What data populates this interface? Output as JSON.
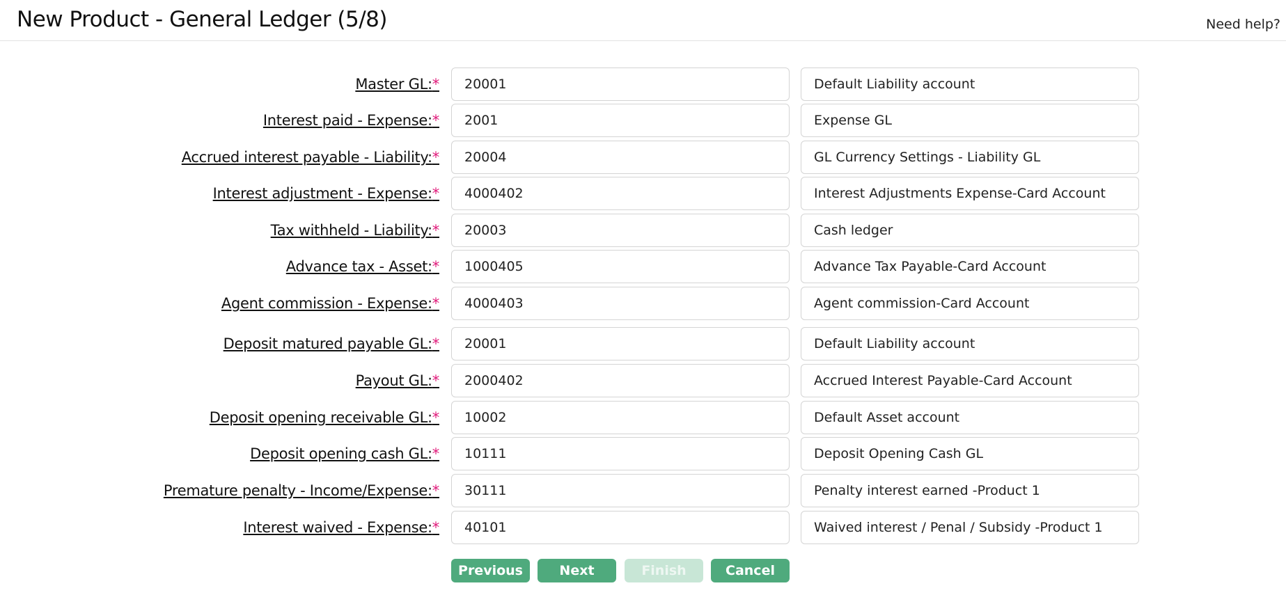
{
  "header": {
    "title": "New Product - General Ledger (5/8)",
    "help_link": "Need help?"
  },
  "required_marker": "*",
  "rows": [
    {
      "label": "Master GL:",
      "gl": "20001",
      "description": "Default Liability account"
    },
    {
      "label": "Interest paid - Expense:",
      "gl": "2001",
      "description": "Expense GL"
    },
    {
      "label": "Accrued interest payable - Liability:",
      "gl": "20004",
      "description": "GL Currency Settings - Liability GL"
    },
    {
      "label": "Interest adjustment - Expense:",
      "gl": "4000402",
      "description": "Interest Adjustments Expense-Card Account"
    },
    {
      "label": "Tax withheld - Liability:",
      "gl": "20003",
      "description": "Cash ledger"
    },
    {
      "label": "Advance tax - Asset:",
      "gl": "1000405",
      "description": "Advance Tax Payable-Card Account"
    },
    {
      "label": "Agent commission - Expense:",
      "gl": "4000403",
      "description": "Agent commission-Card Account"
    },
    {
      "label": "Deposit matured payable GL:",
      "gl": "20001",
      "description": "Default Liability account"
    },
    {
      "label": "Payout GL:",
      "gl": "2000402",
      "description": "Accrued Interest Payable-Card Account"
    },
    {
      "label": "Deposit opening receivable GL:",
      "gl": "10002",
      "description": "Default Asset account"
    },
    {
      "label": "Deposit opening cash GL:",
      "gl": "10111",
      "description": "Deposit Opening Cash GL"
    },
    {
      "label": "Premature penalty - Income/Expense:",
      "gl": "30111",
      "description": "Penalty interest earned -Product 1"
    },
    {
      "label": "Interest waived - Expense:",
      "gl": "40101",
      "description": "Waived interest / Penal / Subsidy -Product 1"
    }
  ],
  "buttons": {
    "previous": "Previous",
    "next": "Next",
    "finish": "Finish",
    "cancel": "Cancel"
  },
  "colors": {
    "button": "#4faa7d",
    "button_disabled": "#c8e6d6",
    "required_marker": "#e0197a"
  }
}
